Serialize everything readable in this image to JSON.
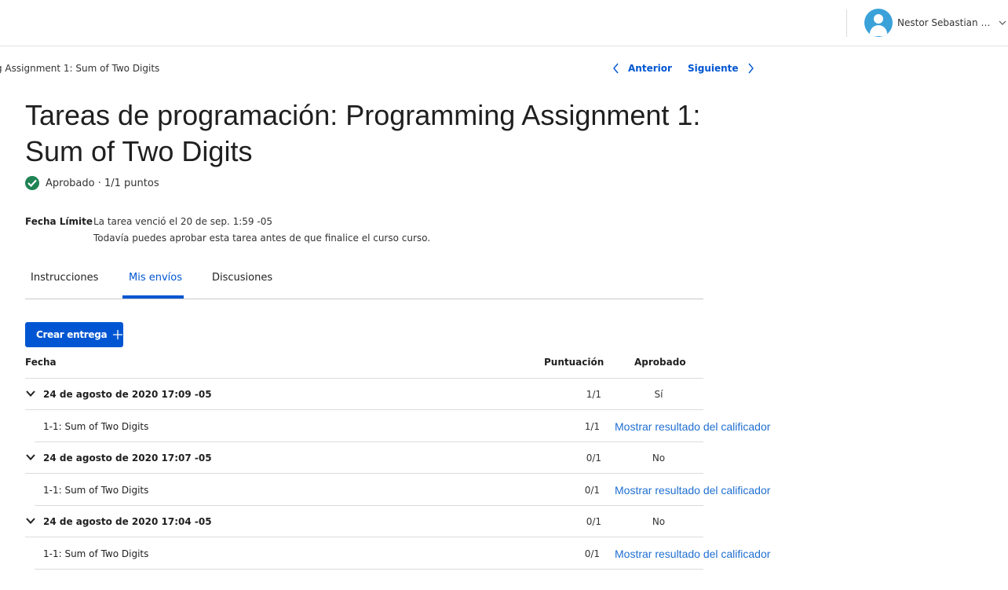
{
  "header": {
    "user_name": "Nestor Sebastian Gar...",
    "avatar_color": "#3ba1d9"
  },
  "breadcrumb": "g Assignment 1: Sum of Two Digits",
  "pager": {
    "prev_label": "Anterior",
    "next_label": "Siguiente"
  },
  "page": {
    "title": "Tareas de programación: Programming Assignment 1: Sum of Two Digits",
    "status_text": "Aprobado · 1/1 puntos",
    "deadline_label": "Fecha Límite",
    "deadline_line1": "La tarea venció el 20 de sep. 1:59 -05",
    "deadline_line2": "Todavía puedes aprobar esta tarea antes de que finalice el curso curso."
  },
  "tabs": [
    {
      "label": "Instrucciones"
    },
    {
      "label": "Mis envíos",
      "active": true
    },
    {
      "label": "Discusiones"
    }
  ],
  "create_button_label": "Crear entrega",
  "table": {
    "headers": {
      "date": "Fecha",
      "score": "Puntuación",
      "passed": "Aprobado"
    },
    "submissions": [
      {
        "date": "24 de agosto de 2020 17:09 -05",
        "score": "1/1",
        "passed": "Sí",
        "part": {
          "name": "1-1: Sum of Two Digits",
          "score": "1/1",
          "feedback_link": "Mostrar resultado del calificador"
        }
      },
      {
        "date": "24 de agosto de 2020 17:07 -05",
        "score": "0/1",
        "passed": "No",
        "part": {
          "name": "1-1: Sum of Two Digits",
          "score": "0/1",
          "feedback_link": "Mostrar resultado del calificador"
        }
      },
      {
        "date": "24 de agosto de 2020 17:04 -05",
        "score": "0/1",
        "passed": "No",
        "part": {
          "name": "1-1: Sum of Two Digits",
          "score": "0/1",
          "feedback_link": "Mostrar resultado del calificador"
        }
      }
    ]
  },
  "colors": {
    "primary": "#0056d2",
    "link": "#1f6fd1",
    "success": "#1f8354"
  }
}
